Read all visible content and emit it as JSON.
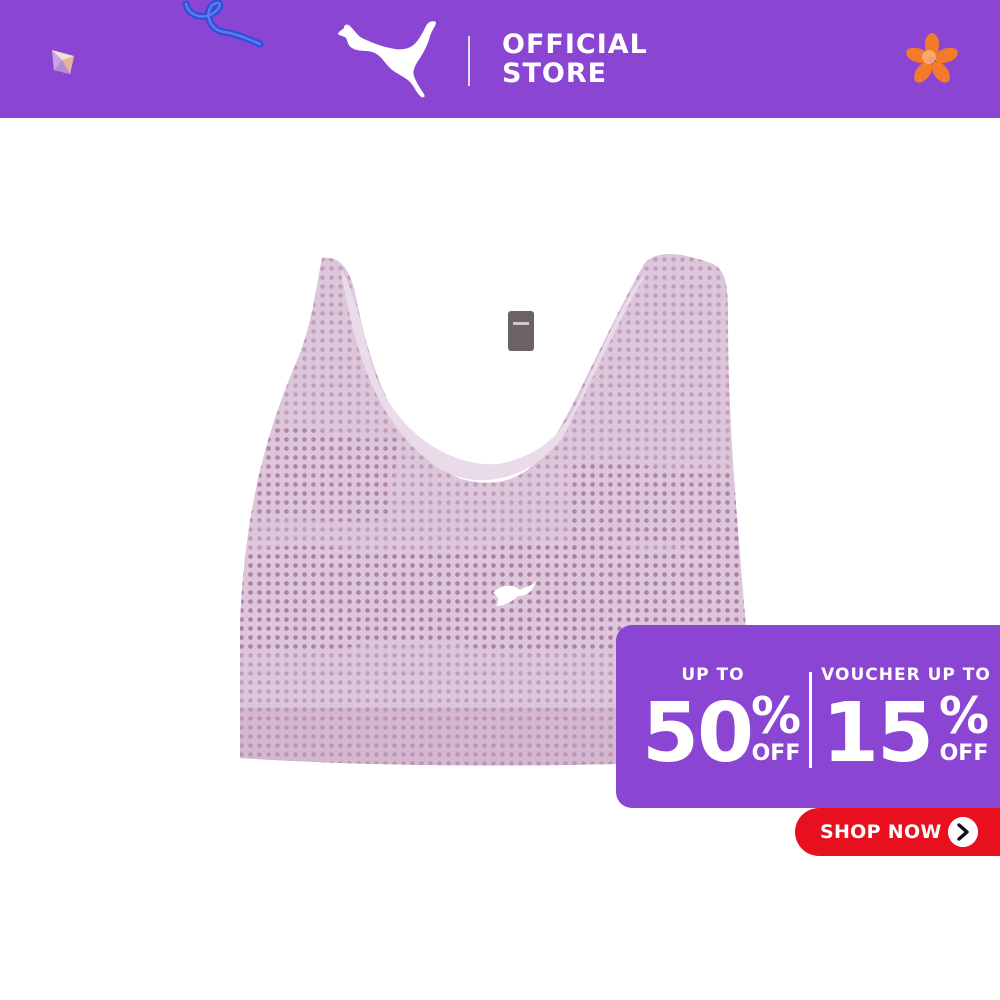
{
  "header": {
    "brand_line1": "OFFICIAL",
    "brand_line2": "STORE",
    "logo_icon": "puma-cat-icon",
    "background_color": "#8a45d3"
  },
  "product": {
    "image_icon": "sports-bra-icon",
    "main_color": "#dcc6da",
    "print_color": "#b07aa3"
  },
  "promo": {
    "left": {
      "heading": "UP TO",
      "value": "50",
      "percent": "%",
      "suffix": "OFF"
    },
    "right": {
      "heading": "VOUCHER UP TO",
      "value": "15",
      "percent": "%",
      "suffix": "OFF"
    },
    "background_color": "#8a45d3"
  },
  "cta": {
    "label": "SHOP NOW",
    "icon": "chevron-right-icon",
    "background_color": "#e8101e"
  }
}
